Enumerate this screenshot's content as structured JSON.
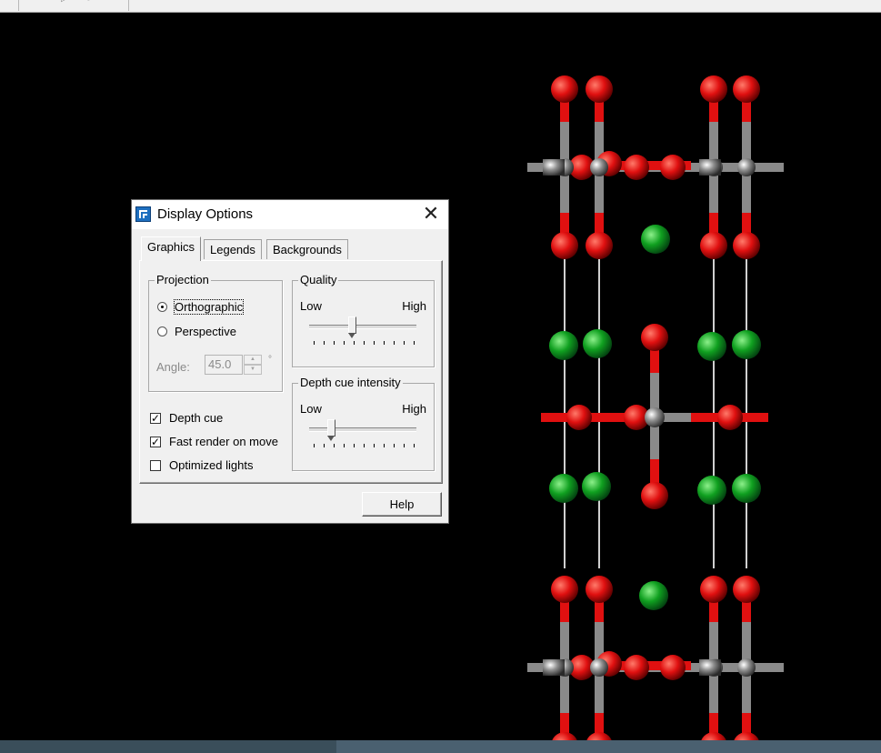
{
  "dialog": {
    "title": "Display Options",
    "close_label": "✕",
    "tabs": [
      {
        "label": "Graphics",
        "active": true
      },
      {
        "label": "Legends",
        "active": false
      },
      {
        "label": "Backgrounds",
        "active": false
      }
    ],
    "projection": {
      "group_label": "Projection",
      "options": [
        {
          "label": "Orthographic",
          "selected": true
        },
        {
          "label": "Perspective",
          "selected": false
        }
      ],
      "angle_label": "Angle:",
      "angle_value": "45.0",
      "angle_unit": "°"
    },
    "checkboxes": [
      {
        "label": "Depth cue",
        "checked": true
      },
      {
        "label": "Fast render on move",
        "checked": true
      },
      {
        "label": "Optimized lights",
        "checked": false
      }
    ],
    "quality": {
      "group_label": "Quality",
      "low_label": "Low",
      "high_label": "High",
      "level": 0.4
    },
    "depth_cue": {
      "group_label": "Depth cue intensity",
      "low_label": "Low",
      "high_label": "High",
      "level": 0.2
    },
    "help_label": "Help"
  },
  "colors": {
    "oxygen": "#e01010",
    "metal": "#909090",
    "chlorine": "#10a020",
    "background": "#000000"
  },
  "icons": [
    "app-icon",
    "close-icon"
  ]
}
